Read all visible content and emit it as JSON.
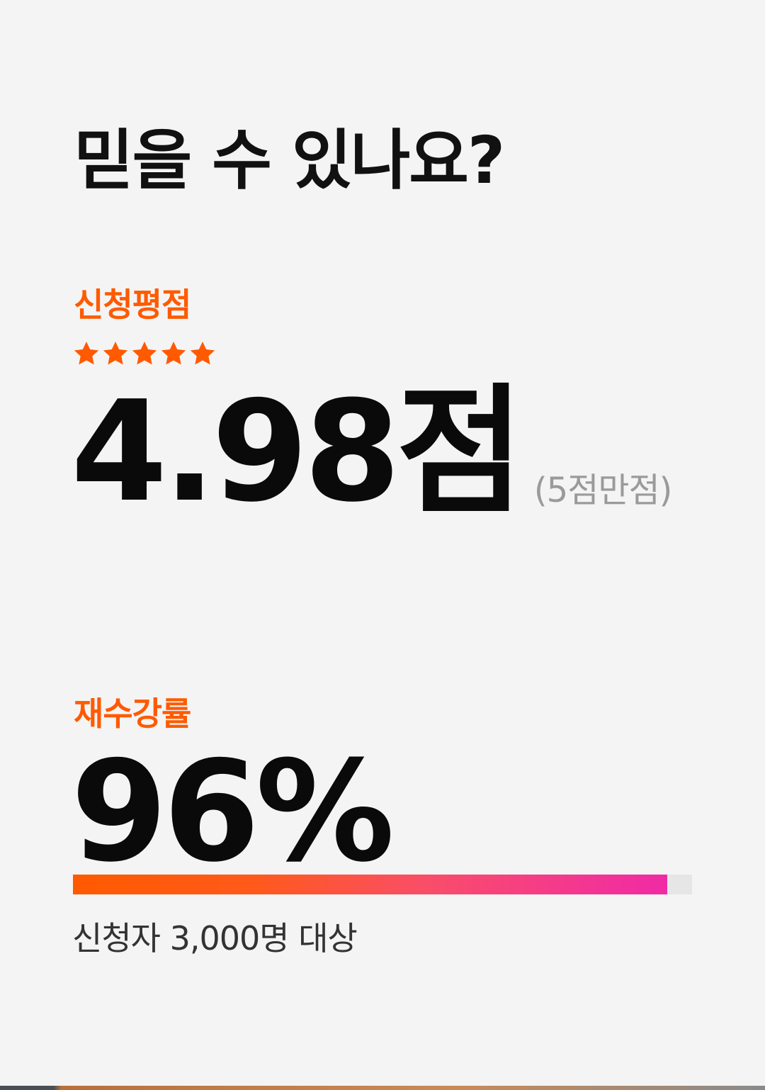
{
  "heading": "믿을 수 있나요?",
  "rating": {
    "label": "신청평점",
    "stars": [
      {
        "icon": "star-icon"
      },
      {
        "icon": "star-icon"
      },
      {
        "icon": "star-icon"
      },
      {
        "icon": "star-icon"
      },
      {
        "icon": "star-icon"
      }
    ],
    "star_color": "#ff5a00",
    "value": "4.98점",
    "suffix": "(5점만점)"
  },
  "retake": {
    "label": "재수강률",
    "value": "96%",
    "progress": 0.96,
    "footnote": "신청자 3,000명 대상"
  },
  "colors": {
    "accent": "#ff5a00",
    "gradient_end": "#f02aa6",
    "background": "#f4f4f4",
    "text": "#111111",
    "muted": "#9a9a9a"
  }
}
